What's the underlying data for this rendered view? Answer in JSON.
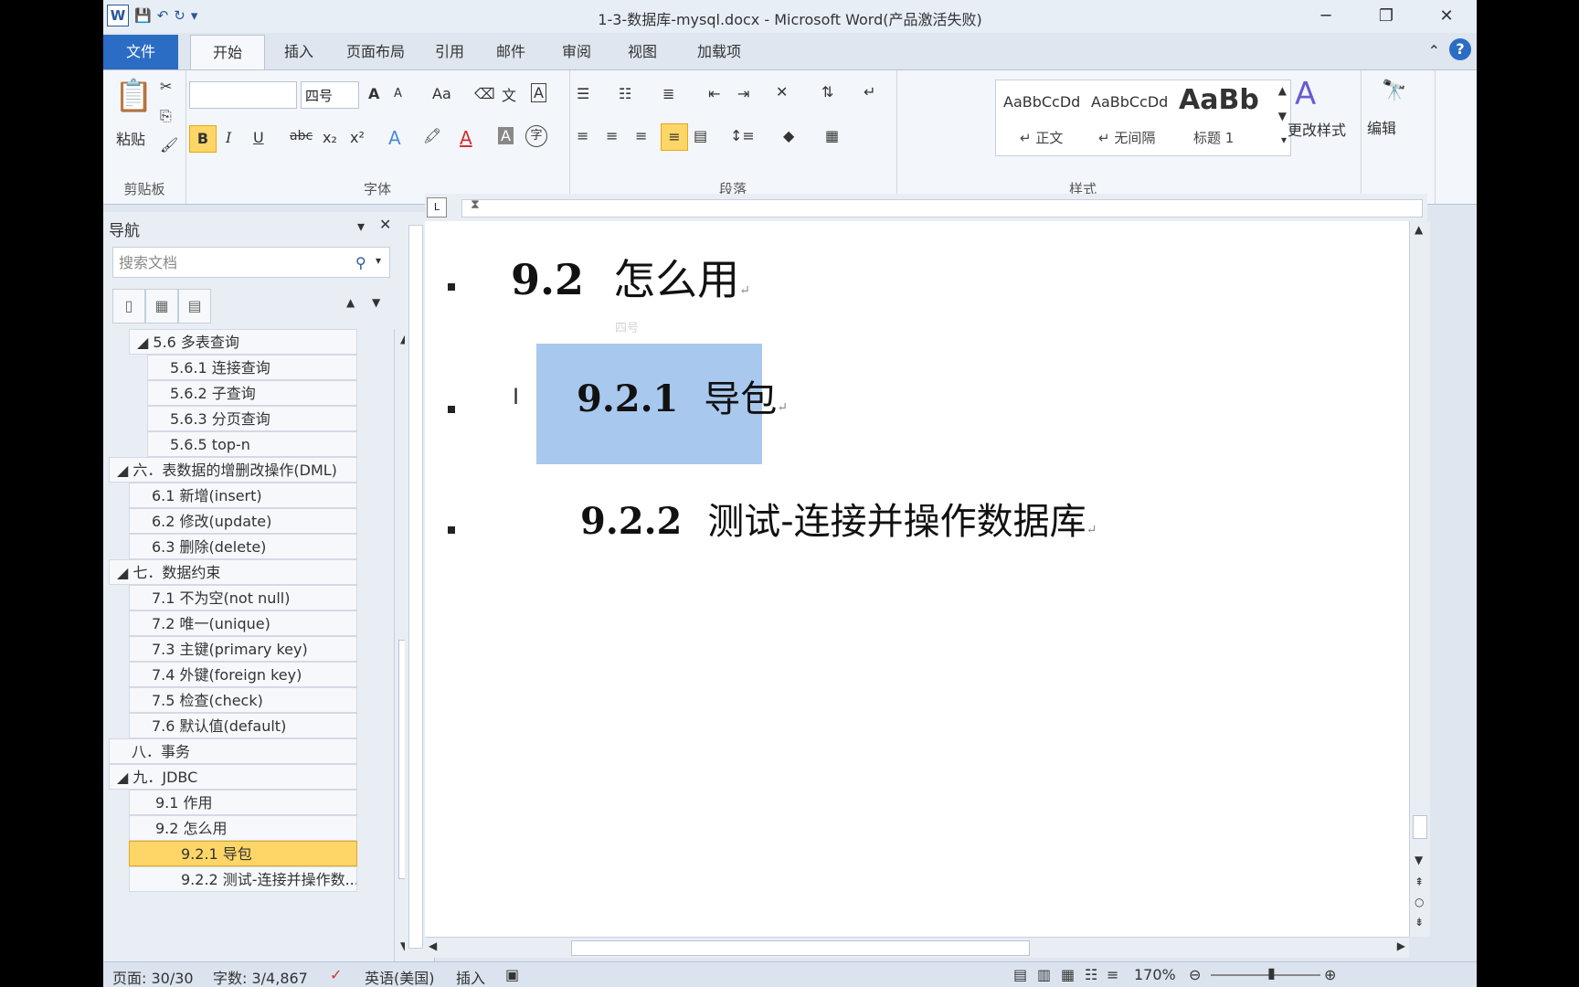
{
  "window": {
    "title": "1-3-数据库-mysql.docx - Microsoft Word(产品激活失败)",
    "minimize": "─",
    "restore": "❐",
    "close": "✕"
  },
  "tabs": [
    "文件",
    "开始",
    "插入",
    "页面布局",
    "引用",
    "邮件",
    "审阅",
    "视图",
    "加载项"
  ],
  "ribbon": {
    "clipboard": {
      "paste": "粘贴",
      "label": "剪贴板"
    },
    "font": {
      "family": "",
      "size": "四号",
      "grow": "A",
      "shrink": "A",
      "case": "Aa",
      "bold": "B",
      "italic": "I",
      "underline": "U",
      "strike": "abc",
      "sub": "x₂",
      "sup": "x²",
      "label": "字体"
    },
    "paragraph": {
      "label": "段落"
    },
    "styles": {
      "s1_preview": "AaBbCcDd",
      "s1_name": "↵ 正文",
      "s2_preview": "AaBbCcDd",
      "s2_name": "↵ 无间隔",
      "s3_preview": "AaBb",
      "s3_name": "标题 1",
      "change": "更改样式",
      "label": "样式"
    },
    "edit": {
      "label": "编辑"
    }
  },
  "nav": {
    "title": "导航",
    "search_placeholder": "搜索文档",
    "items": [
      {
        "text": "◢ 5.6 多表查询"
      },
      {
        "text": "5.6.1 连接查询"
      },
      {
        "text": "5.6.2 子查询"
      },
      {
        "text": "5.6.3 分页查询"
      },
      {
        "text": "5.6.5 top-n"
      },
      {
        "text": "◢ 六．表数据的增删改操作(DML)"
      },
      {
        "text": "6.1 新增(insert)"
      },
      {
        "text": "6.2 修改(update)"
      },
      {
        "text": "6.3 删除(delete)"
      },
      {
        "text": "◢ 七．数据约束"
      },
      {
        "text": "7.1 不为空(not  null)"
      },
      {
        "text": "7.2 唯一(unique)"
      },
      {
        "text": "7.3 主键(primary  key)"
      },
      {
        "text": "7.4 外键(foreign  key)"
      },
      {
        "text": "7.5 检查(check)"
      },
      {
        "text": "7.6 默认值(default)"
      },
      {
        "text": "八．事务"
      },
      {
        "text": "◢ 九．JDBC"
      },
      {
        "text": "9.1 作用"
      },
      {
        "text": "9.2 怎么用"
      },
      {
        "text": "9.2.1 导包"
      },
      {
        "text": "9.2.2 测试-连接并操作数..."
      }
    ]
  },
  "doc": {
    "h1_num": "9.2",
    "h1_text": "怎么用",
    "h2a_num": "9.2.1",
    "h2a_text": "导包",
    "h2b_num": "9.2.2",
    "h2b_text": "测试-连接并操作数据库",
    "para_mark": "↵",
    "mini_size": "四号"
  },
  "status": {
    "page": "页面: 30/30",
    "words": "字数: 3/4,867",
    "lang": "英语(美国)",
    "mode": "插入",
    "zoom": "170%"
  },
  "colors": {
    "accent": "#2b6cc4",
    "selection": "#a8c8ee",
    "nav_selected": "#fdd667"
  }
}
